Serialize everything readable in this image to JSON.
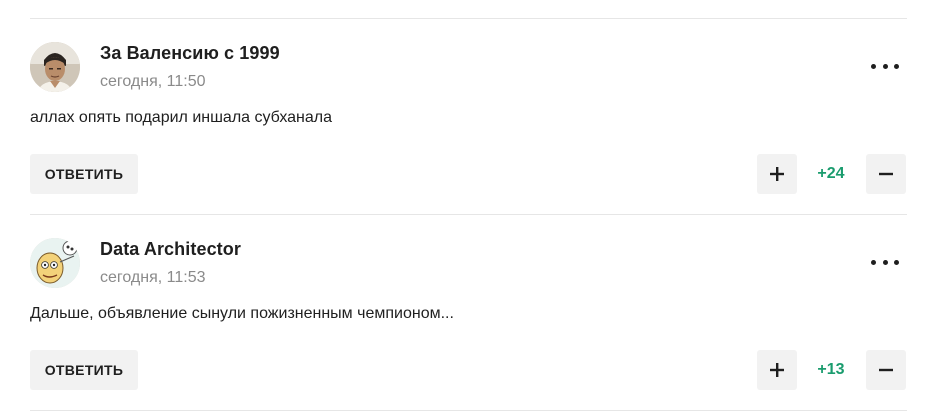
{
  "comments": [
    {
      "author": "За Валенсию с 1999",
      "time": "сегодня, 11:50",
      "text": "аллах опять подарил иншала субханала",
      "reply_label": "ОТВЕТИТЬ",
      "score": "+24",
      "avatar_icon": "user-photo-avatar",
      "more_icon": "more-dots-icon",
      "upvote_icon": "plus-icon",
      "downvote_icon": "minus-icon"
    },
    {
      "author": "Data Architector",
      "time": "сегодня, 11:53",
      "text": "Дальше, объявление сынули пожизненным чемпионом...",
      "reply_label": "ОТВЕТИТЬ",
      "score": "+13",
      "avatar_icon": "cartoon-avatar",
      "more_icon": "more-dots-icon",
      "upvote_icon": "plus-icon",
      "downvote_icon": "minus-icon"
    }
  ],
  "colors": {
    "score_positive": "#1a9c6e",
    "button_bg": "#f2f2f2",
    "divider": "#e6e6e6",
    "meta_text": "#8a8a8a"
  }
}
